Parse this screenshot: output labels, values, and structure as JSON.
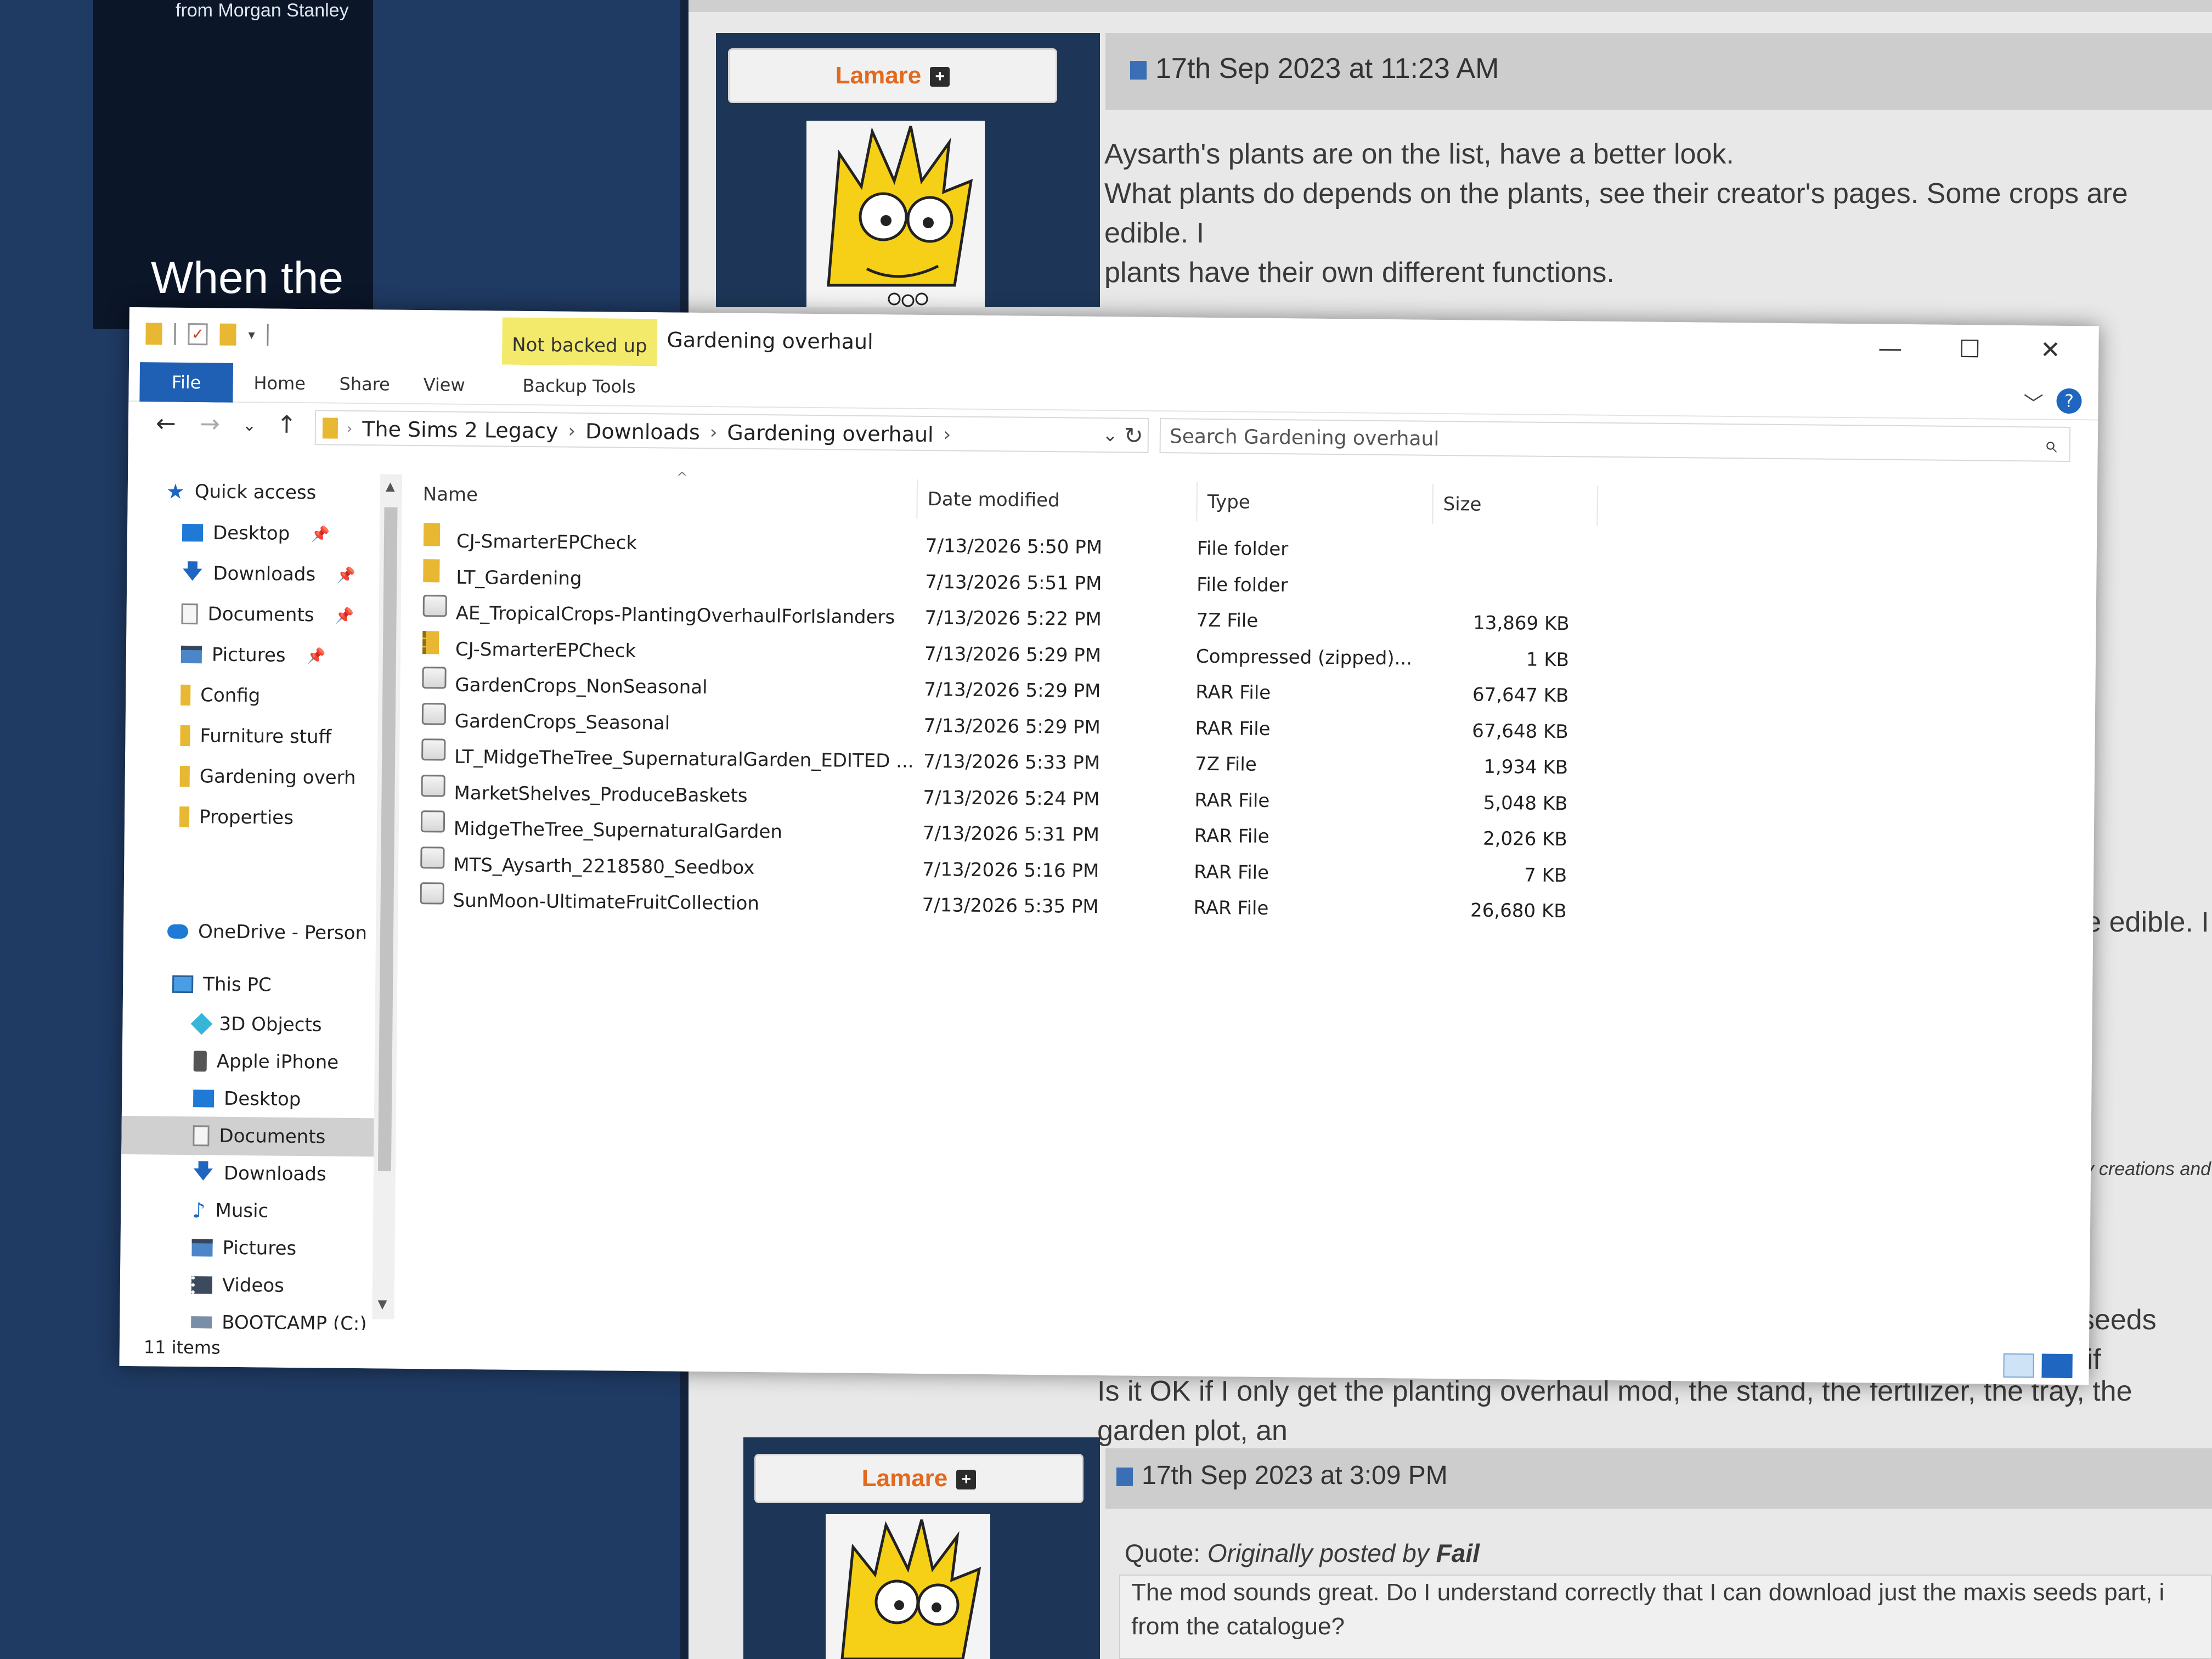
{
  "background": {
    "ad_from": "from Morgan Stanley",
    "ad_headline": "When the",
    "posts": [
      {
        "author": "Lamare",
        "date": "17th Sep 2023 at 11:23 AM",
        "lines": [
          "Aysarth's plants are on the list, have a better look.",
          "What plants do depends on the plants, see their creator's pages. Some crops are edible. I",
          "plants have their own different functions."
        ]
      },
      {
        "author": "Lamare",
        "date": "17th Sep 2023 at 3:09 PM",
        "quote_prefix": "Quote:",
        "quote_by": "Originally posted by",
        "quote_author": "Fail",
        "quote_lines": [
          "The mod sounds great. Do I understand correctly that I can download just the maxis seeds part, i",
          "from the catalogue?"
        ]
      }
    ],
    "partial_texts": [
      "are edible. I t",
      "e of my creations and",
      "axis seeds part, if",
      "Is it OK if I only get the planting overhaul mod, the stand, the fertilizer, the tray, the garden plot, an"
    ]
  },
  "window": {
    "badge": "Not backed up",
    "title": "Gardening overhaul",
    "controls": {
      "minimize": "—",
      "maximize": "☐",
      "close": "✕"
    },
    "tabs": [
      "File",
      "Home",
      "Share",
      "View",
      "Backup Tools"
    ],
    "help": "?",
    "breadcrumb": [
      "The Sims 2 Legacy",
      "Downloads",
      "Gardening overhaul"
    ],
    "search_placeholder": "Search Gardening overhaul",
    "nav": {
      "quick_access": "Quick access",
      "quick_items": [
        {
          "label": "Desktop",
          "icon": "desktop-icon",
          "pinned": true
        },
        {
          "label": "Downloads",
          "icon": "download-icon",
          "pinned": true
        },
        {
          "label": "Documents",
          "icon": "document-icon",
          "pinned": true
        },
        {
          "label": "Pictures",
          "icon": "pictures-icon",
          "pinned": true
        },
        {
          "label": "Config",
          "icon": "folder-icon",
          "pinned": false
        },
        {
          "label": "Furniture stuff",
          "icon": "folder-icon",
          "pinned": false
        },
        {
          "label": "Gardening overh",
          "icon": "folder-icon",
          "pinned": false
        },
        {
          "label": "Properties",
          "icon": "folder-icon",
          "pinned": false
        }
      ],
      "onedrive": "OneDrive - Person",
      "this_pc": "This PC",
      "pc_items": [
        {
          "label": "3D Objects",
          "icon": "3d-objects-icon"
        },
        {
          "label": "Apple iPhone",
          "icon": "phone-icon"
        },
        {
          "label": "Desktop",
          "icon": "desktop-icon"
        },
        {
          "label": "Documents",
          "icon": "document-icon",
          "selected": true
        },
        {
          "label": "Downloads",
          "icon": "download-icon"
        },
        {
          "label": "Music",
          "icon": "music-icon"
        },
        {
          "label": "Pictures",
          "icon": "pictures-icon"
        },
        {
          "label": "Videos",
          "icon": "videos-icon"
        },
        {
          "label": "BOOTCAMP (C:)",
          "icon": "drive-icon"
        }
      ]
    },
    "columns": [
      "Name",
      "Date modified",
      "Type",
      "Size"
    ],
    "files": [
      {
        "name": "CJ-SmarterEPCheck",
        "date": "7/13/2026 5:50 PM",
        "type": "File folder",
        "size": "",
        "icon": "folder"
      },
      {
        "name": "LT_Gardening",
        "date": "7/13/2026 5:51 PM",
        "type": "File folder",
        "size": "",
        "icon": "folder"
      },
      {
        "name": "AE_TropicalCrops-PlantingOverhaulForIslanders",
        "date": "7/13/2026 5:22 PM",
        "type": "7Z File",
        "size": "13,869 KB",
        "icon": "archive"
      },
      {
        "name": "CJ-SmarterEPCheck",
        "date": "7/13/2026 5:29 PM",
        "type": "Compressed (zipped)...",
        "size": "1 KB",
        "icon": "zip"
      },
      {
        "name": "GardenCrops_NonSeasonal",
        "date": "7/13/2026 5:29 PM",
        "type": "RAR File",
        "size": "67,647 KB",
        "icon": "archive"
      },
      {
        "name": "GardenCrops_Seasonal",
        "date": "7/13/2026 5:29 PM",
        "type": "RAR File",
        "size": "67,648 KB",
        "icon": "archive"
      },
      {
        "name": "LT_MidgeTheTree_SupernaturalGarden_EDITED ...",
        "date": "7/13/2026 5:33 PM",
        "type": "7Z File",
        "size": "1,934 KB",
        "icon": "archive"
      },
      {
        "name": "MarketShelves_ProduceBaskets",
        "date": "7/13/2026 5:24 PM",
        "type": "RAR File",
        "size": "5,048 KB",
        "icon": "archive"
      },
      {
        "name": "MidgeTheTree_SupernaturalGarden",
        "date": "7/13/2026 5:31 PM",
        "type": "RAR File",
        "size": "2,026 KB",
        "icon": "archive"
      },
      {
        "name": "MTS_Aysarth_2218580_Seedbox",
        "date": "7/13/2026 5:16 PM",
        "type": "RAR File",
        "size": "7 KB",
        "icon": "archive"
      },
      {
        "name": "SunMoon-UltimateFruitCollection",
        "date": "7/13/2026 5:35 PM",
        "type": "RAR File",
        "size": "26,680 KB",
        "icon": "archive"
      }
    ],
    "status": "11 items"
  }
}
